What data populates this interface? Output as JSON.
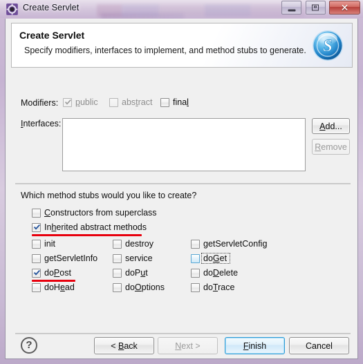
{
  "window": {
    "title": "Create Servlet",
    "icon": "servlet-gear-icon",
    "controls": {
      "minimize": "Minimize",
      "maximize": "Maximize",
      "close": "Close"
    }
  },
  "banner": {
    "title": "Create Servlet",
    "subtitle": "Specify modifiers, interfaces to implement, and method stubs to generate.",
    "icon": "blue-s-sphere-icon"
  },
  "modifiers": {
    "label": "Modifiers:",
    "items": [
      {
        "label": "public",
        "mnemonic": "p",
        "checked": true,
        "enabled": false
      },
      {
        "label": "abstract",
        "mnemonic": "t",
        "checked": false,
        "enabled": false
      },
      {
        "label": "final",
        "mnemonic": "l",
        "checked": false,
        "enabled": true
      }
    ]
  },
  "interfaces": {
    "label": "Interfaces:",
    "mnemonic": "I",
    "items": [],
    "add_button": "Add...",
    "add_mnemonic": "A",
    "remove_button": "Remove",
    "remove_mnemonic": "R",
    "remove_enabled": false
  },
  "stubs": {
    "question": "Which method stubs would you like to create?",
    "top_options": [
      {
        "label": "Constructors from superclass",
        "mnemonic": "C",
        "checked": false,
        "annotated": false
      },
      {
        "label": "Inherited abstract methods",
        "mnemonic": "h",
        "checked": true,
        "annotated": true
      }
    ],
    "grid": [
      [
        {
          "label": "init",
          "mnemonic": "",
          "checked": false,
          "focused": false,
          "annotated": false
        },
        {
          "label": "destroy",
          "mnemonic": "",
          "checked": false,
          "focused": false,
          "annotated": false
        },
        {
          "label": "getServletConfig",
          "mnemonic": "",
          "checked": false,
          "focused": false,
          "annotated": false
        }
      ],
      [
        {
          "label": "getServletInfo",
          "mnemonic": "",
          "checked": false,
          "focused": false,
          "annotated": false
        },
        {
          "label": "service",
          "mnemonic": "",
          "checked": false,
          "focused": false,
          "annotated": false
        },
        {
          "label": "doGet",
          "mnemonic": "G",
          "checked": false,
          "focused": true,
          "annotated": false
        }
      ],
      [
        {
          "label": "doPost",
          "mnemonic": "P",
          "checked": true,
          "focused": false,
          "annotated": true
        },
        {
          "label": "doPut",
          "mnemonic": "u",
          "checked": false,
          "focused": false,
          "annotated": false
        },
        {
          "label": "doDelete",
          "mnemonic": "D",
          "checked": false,
          "focused": false,
          "annotated": false
        }
      ],
      [
        {
          "label": "doHead",
          "mnemonic": "e",
          "checked": false,
          "focused": false,
          "annotated": false
        },
        {
          "label": "doOptions",
          "mnemonic": "O",
          "checked": false,
          "focused": false,
          "annotated": false
        },
        {
          "label": "doTrace",
          "mnemonic": "T",
          "checked": false,
          "focused": false,
          "annotated": false
        }
      ]
    ]
  },
  "footer": {
    "help": "?",
    "back": "< Back",
    "back_mnemonic": "B",
    "next": "Next >",
    "next_mnemonic": "N",
    "next_enabled": false,
    "finish": "Finish",
    "finish_mnemonic": "F",
    "finish_default": true,
    "cancel": "Cancel"
  },
  "colors": {
    "accent": "#2e9bd6",
    "annotation": "#e8000d",
    "dialog_bg": "#f0f0f0",
    "frame": "#c6b3d2",
    "close_button": "#b53f3a"
  }
}
